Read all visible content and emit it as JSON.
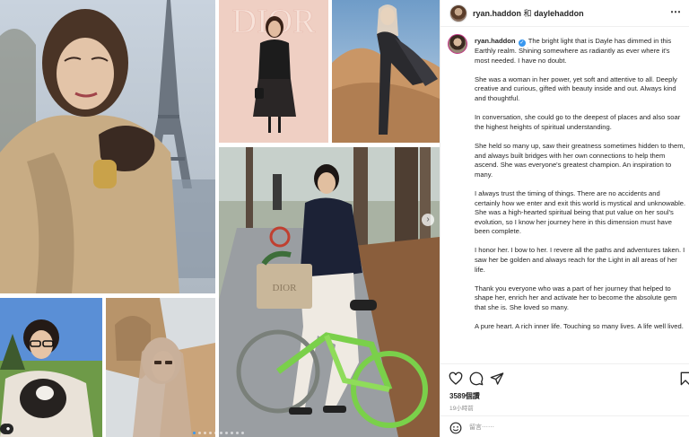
{
  "header": {
    "user1": "ryan.haddon",
    "conjunction": "和",
    "user2": "daylehaddon",
    "more_icon": "more-icon"
  },
  "caption": {
    "username": "ryan.haddon",
    "verified": "✓",
    "paragraphs": [
      "The bright light that is Dayle has dimmed in this Earthly realm. Shining somewhere as radiantly as ever where it's most needed. I have no doubt.",
      "She was a woman in her power, yet soft and attentive to all. Deeply creative and curious, gifted with beauty inside and out. Always kind and thoughtful.",
      "In conversation, she could go to the deepest of places and also soar the highest heights of spiritual understanding.",
      "She held so many up, saw their greatness sometimes hidden to them, and always built bridges with her own connections to help them ascend. She was everyone's greatest champion. An inspiration to many.",
      "I always trust the timing of things. There are no accidents and certainly how we enter and exit this world is mystical and unknowable. She was a high-hearted spiritual being that put value on her soul's evolution, so I know her journey here in this dimension must have been complete.",
      "I honor her. I bow to her. I revere all the paths and adventures taken. I saw her be golden and always reach for the Light in all areas of her life.",
      "Thank you everyone who was a part of her journey that helped to shape her, enrich her and activate her to become the absolute gem that she is. She loved so many.",
      "A pure heart. A rich inner life. Touching so many lives. A life well lived."
    ]
  },
  "media": {
    "photo_label": "DIOR",
    "bag_label": "DIOR",
    "next_icon": "›",
    "dots_total": 10,
    "dots_active": 0
  },
  "stats": {
    "likes": "3589個讚",
    "time": "19小時前"
  },
  "comment": {
    "placeholder": "留言⋯⋯"
  },
  "colors": {
    "accent": "#3897f0",
    "text": "#262626",
    "secondary": "#8e8e8e",
    "divider": "#efefef"
  },
  "icons": [
    "heart-icon",
    "comment-icon",
    "share-icon",
    "bookmark-icon",
    "emoji-icon",
    "verified-icon",
    "tag-user-icon",
    "chevron-right-icon"
  ]
}
